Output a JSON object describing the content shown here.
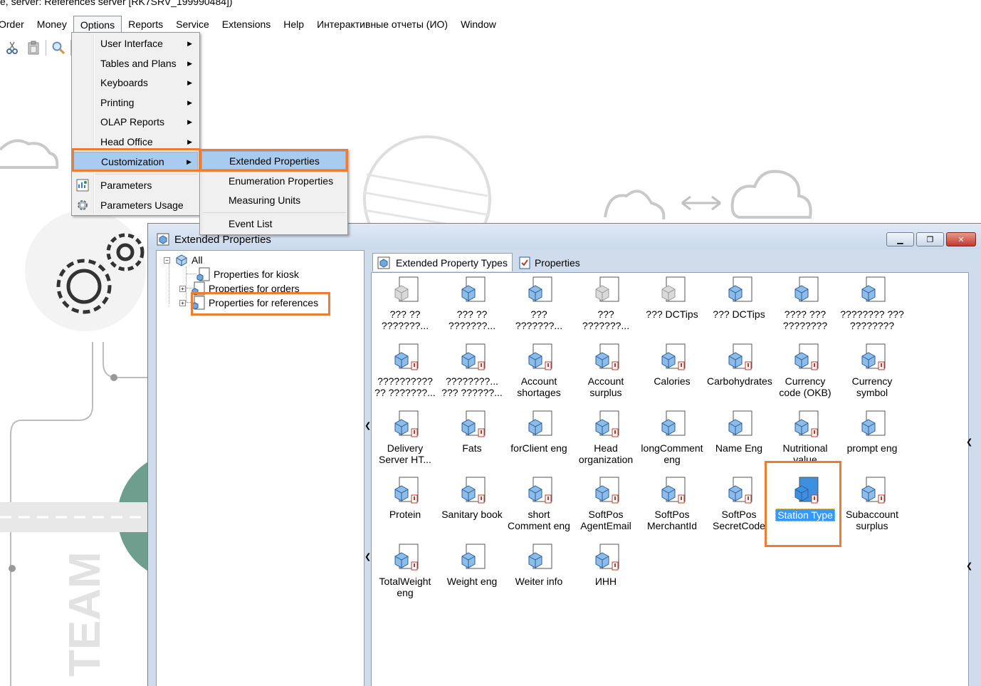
{
  "window_caption": "e, server: References server [RK7SRV_199990484])",
  "menubar": {
    "items": [
      {
        "label": "Order"
      },
      {
        "label": "Money"
      },
      {
        "label": "Options"
      },
      {
        "label": "Reports"
      },
      {
        "label": "Service"
      },
      {
        "label": "Extensions"
      },
      {
        "label": "Help"
      },
      {
        "label": "Интерактивные отчеты (ИО)"
      },
      {
        "label": "Window"
      }
    ]
  },
  "toolbar": {
    "icons": [
      "scissors-icon",
      "clipboard-icon",
      "magnifier-icon"
    ]
  },
  "options_menu": {
    "items": [
      {
        "label": "User Interface"
      },
      {
        "label": "Tables and Plans"
      },
      {
        "label": "Keyboards"
      },
      {
        "label": "Printing"
      },
      {
        "label": "OLAP Reports"
      },
      {
        "label": "Head Office"
      },
      {
        "label": "Customization"
      },
      {
        "label": "Parameters"
      },
      {
        "label": "Parameters Usage"
      }
    ]
  },
  "customization_submenu": {
    "items": [
      {
        "label": "Extended Properties"
      },
      {
        "label": "Enumeration Properties"
      },
      {
        "label": "Measuring Units"
      },
      {
        "label": "Event List"
      }
    ]
  },
  "ext_window": {
    "title": "Extended Properties",
    "tree": {
      "root": "All",
      "nodes": [
        {
          "label": "Properties for kiosk"
        },
        {
          "label": "Properties for orders"
        },
        {
          "label": "Properties for references"
        }
      ]
    },
    "tabs": [
      {
        "label": "Extended Property Types"
      },
      {
        "label": "Properties"
      }
    ],
    "grid": {
      "items": [
        {
          "label": "??? ?? ???????..."
        },
        {
          "label": "??? ?? ???????..."
        },
        {
          "label": "??? ???????..."
        },
        {
          "label": "??? ???????..."
        },
        {
          "label": "??? DCTips"
        },
        {
          "label": "??? DCTips"
        },
        {
          "label": "???? ??? ????????"
        },
        {
          "label": "???????? ??? ????????"
        },
        {
          "label": "?????????? ?? ???????..."
        },
        {
          "label": "????????... ??? ??????..."
        },
        {
          "label": "Account shortages"
        },
        {
          "label": "Account surplus"
        },
        {
          "label": "Calories"
        },
        {
          "label": "Carbohydrates"
        },
        {
          "label": "Currency code (OKB)"
        },
        {
          "label": "Currency symbol"
        },
        {
          "label": "Delivery Server HT..."
        },
        {
          "label": "Fats"
        },
        {
          "label": "forClient eng"
        },
        {
          "label": "Head organization"
        },
        {
          "label": "longComment eng"
        },
        {
          "label": "Name Eng"
        },
        {
          "label": "Nutritional value"
        },
        {
          "label": "prompt eng"
        },
        {
          "label": "Protein"
        },
        {
          "label": "Sanitary book"
        },
        {
          "label": "short Comment eng"
        },
        {
          "label": "SoftPos AgentEmail"
        },
        {
          "label": "SoftPos MerchantId"
        },
        {
          "label": "SoftPos SecretCode"
        },
        {
          "label": "Station Type"
        },
        {
          "label": "Subaccount surplus"
        },
        {
          "label": "TotalWeight eng"
        },
        {
          "label": "Weight eng"
        },
        {
          "label": "Weiter info"
        },
        {
          "label": "ИНН"
        }
      ]
    }
  },
  "background_text": "TEAM",
  "colors": {
    "highlight_border": "#ef7d31",
    "menu_highlight": "#a8ccef",
    "selection": "#3399ff"
  }
}
